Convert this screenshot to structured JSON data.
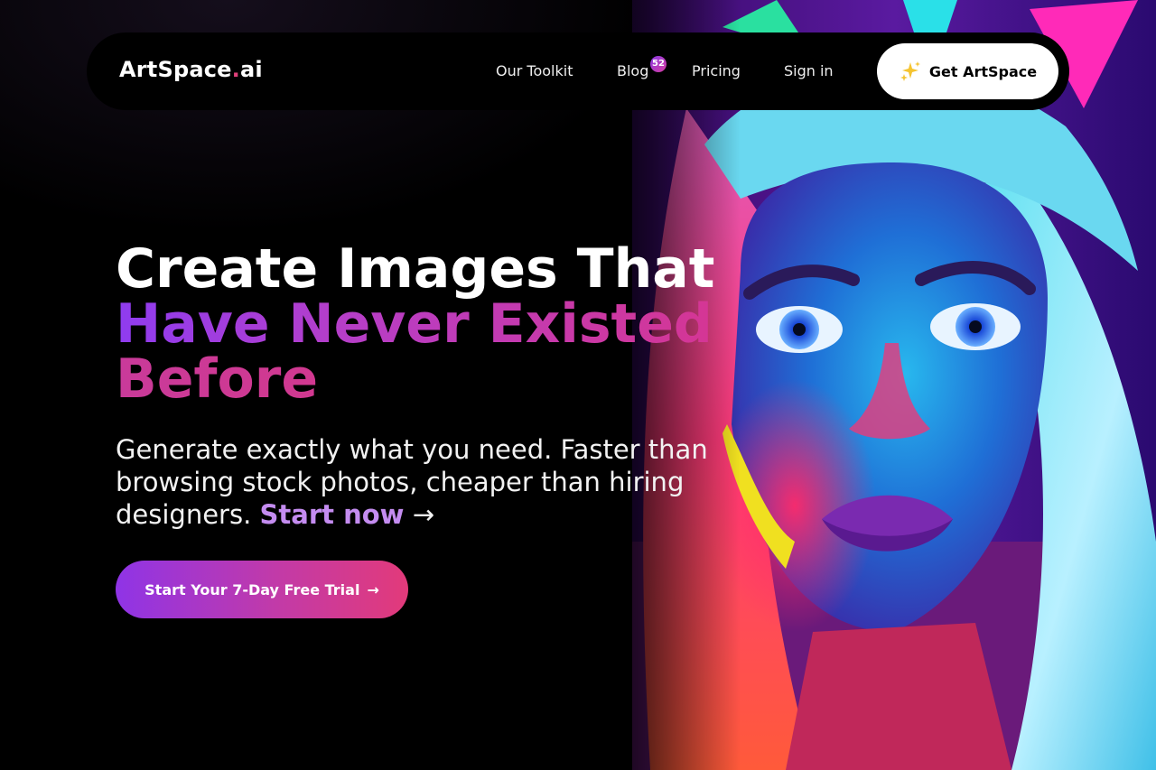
{
  "nav": {
    "brand_name": "ArtSpace",
    "brand_dot": ".",
    "brand_suffix": "ai",
    "links": {
      "toolkit": "Our Toolkit",
      "blog": "Blog",
      "blog_badge": "52",
      "pricing": "Pricing",
      "signin": "Sign in"
    },
    "cta_label": "Get ArtSpace",
    "cta_icon": "sparkles-icon"
  },
  "hero": {
    "headline_line1": "Create Images That",
    "headline_line2": "Have Never Existed",
    "headline_line3": "Before",
    "sub_text": "Generate exactly what you need. Faster than browsing stock photos, cheaper than hiring designers.",
    "sub_link": "Start now",
    "sub_arrow": "→",
    "trial_label": "Start Your 7-Day Free Trial",
    "trial_arrow": "→",
    "image": "neon-portrait-illustration"
  },
  "colors": {
    "background": "#000000",
    "accent_purple": "#8f3cf0",
    "accent_pink": "#e2357a",
    "link_accent": "#c48cf0"
  }
}
